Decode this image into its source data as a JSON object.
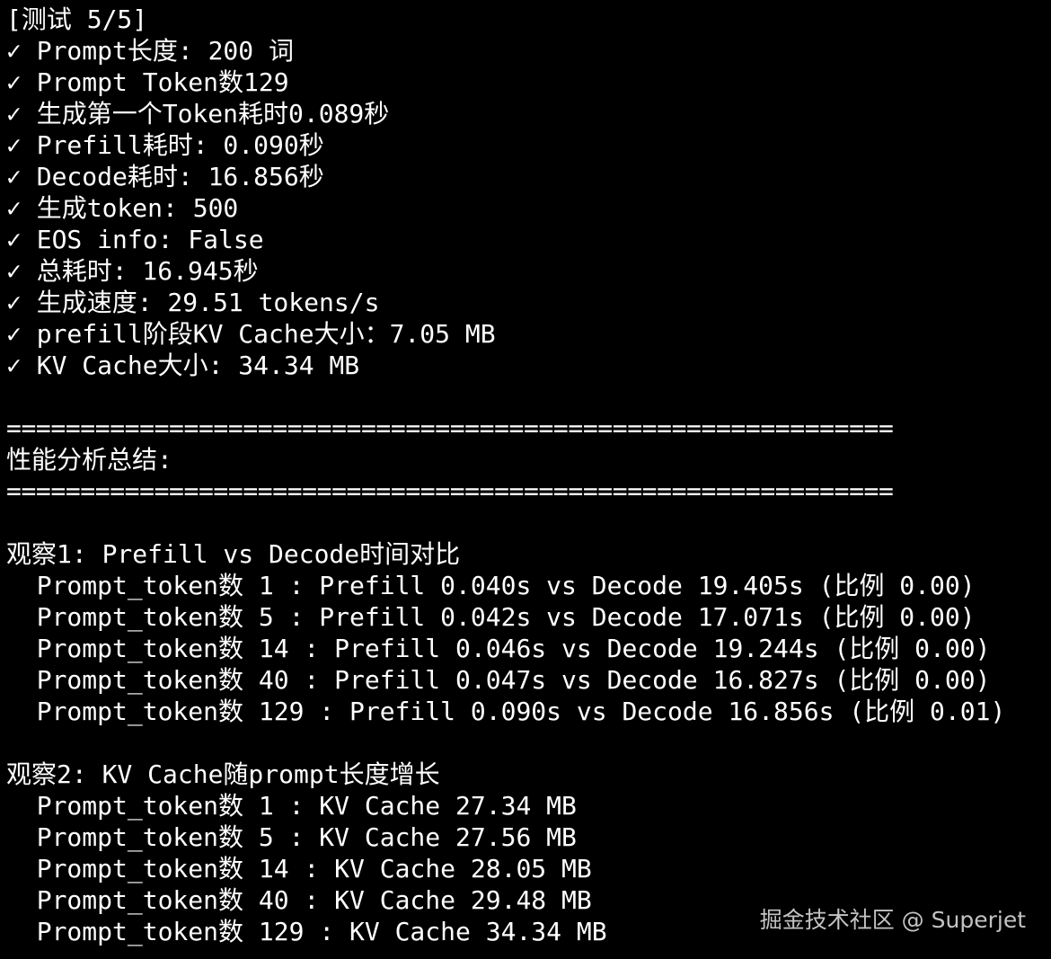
{
  "terminal": {
    "header": "[测试 5/5]",
    "test_results": [
      "✓ Prompt长度: 200 词",
      "✓ Prompt Token数129",
      "✓ 生成第一个Token耗时0.089秒",
      "✓ Prefill耗时: 0.090秒",
      "✓ Decode耗时: 16.856秒",
      "✓ 生成token: 500",
      "✓ EOS info: False",
      "✓ 总耗时: 16.945秒",
      "✓ 生成速度: 29.51 tokens/s",
      "✓ prefill阶段KV Cache大小：7.05 MB",
      "✓ KV Cache大小: 34.34 MB"
    ],
    "separator_top": "============================================================",
    "summary_title": "性能分析总结:",
    "separator_bottom": "============================================================",
    "observation1": {
      "title": "观察1: Prefill vs Decode时间对比",
      "rows": [
        "  Prompt_token数 1 : Prefill 0.040s vs Decode 19.405s (比例 0.00)",
        "  Prompt_token数 5 : Prefill 0.042s vs Decode 17.071s (比例 0.00)",
        "  Prompt_token数 14 : Prefill 0.046s vs Decode 19.244s (比例 0.00)",
        "  Prompt_token数 40 : Prefill 0.047s vs Decode 16.827s (比例 0.00)",
        "  Prompt_token数 129 : Prefill 0.090s vs Decode 16.856s (比例 0.01)"
      ]
    },
    "observation2": {
      "title": "观察2: KV Cache随prompt长度增长",
      "rows": [
        "  Prompt_token数 1 : KV Cache 27.34 MB",
        "  Prompt_token数 5 : KV Cache 27.56 MB",
        "  Prompt_token数 14 : KV Cache 28.05 MB",
        "  Prompt_token数 40 : KV Cache 29.48 MB",
        "  Prompt_token数 129 : KV Cache 34.34 MB"
      ]
    }
  },
  "watermark": "掘金技术社区 @ Superjet",
  "colors": {
    "background": "#000000",
    "text": "#ffffff",
    "watermark": "#d9d9d9"
  }
}
